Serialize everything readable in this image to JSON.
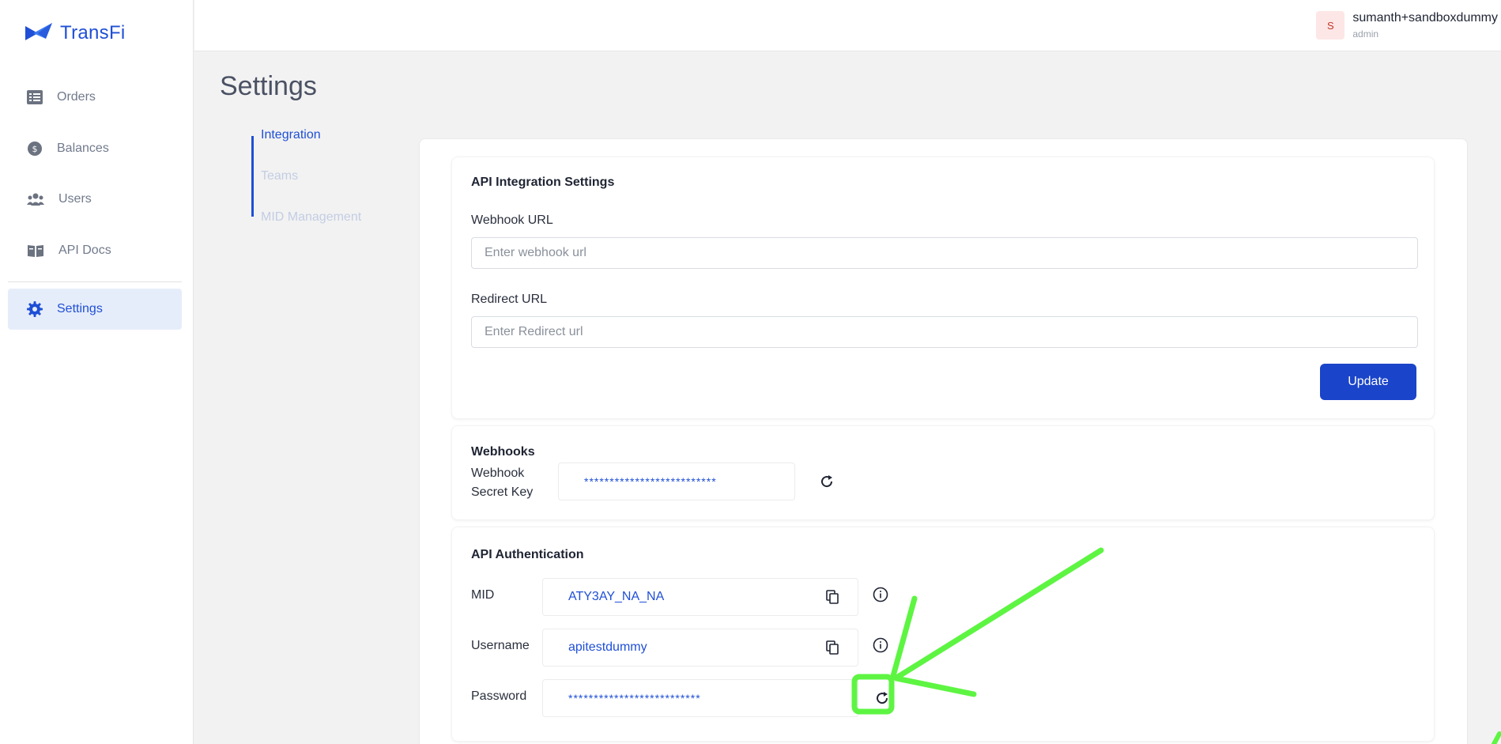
{
  "brand": {
    "name": "TransFi"
  },
  "sidebar": {
    "items": [
      {
        "label": "Orders",
        "icon": "list-icon"
      },
      {
        "label": "Balances",
        "icon": "coin-icon"
      },
      {
        "label": "Users",
        "icon": "users-icon"
      },
      {
        "label": "API Docs",
        "icon": "book-icon"
      },
      {
        "label": "Settings",
        "icon": "gear-icon",
        "active": true
      }
    ]
  },
  "header": {
    "user": {
      "initial": "S",
      "name": "sumanth+sandboxdummy",
      "role": "admin"
    }
  },
  "page": {
    "title": "Settings"
  },
  "subnav": {
    "items": [
      {
        "label": "Integration",
        "active": true
      },
      {
        "label": "Teams"
      },
      {
        "label": "MID Management"
      }
    ]
  },
  "api_integration": {
    "title": "API Integration Settings",
    "webhook_url": {
      "label": "Webhook URL",
      "placeholder": "Enter webhook url",
      "value": ""
    },
    "redirect_url": {
      "label": "Redirect URL",
      "placeholder": "Enter Redirect url",
      "value": ""
    },
    "update_label": "Update"
  },
  "webhooks": {
    "title": "Webhooks",
    "secret_label_line1": "Webhook",
    "secret_label_line2": "Secret Key",
    "secret_value": "**************************"
  },
  "api_auth": {
    "title": "API Authentication",
    "mid": {
      "label": "MID",
      "value": "ATY3AY_NA_NA"
    },
    "username": {
      "label": "Username",
      "value": "apitestdummy"
    },
    "password": {
      "label": "Password",
      "value": "**************************"
    }
  },
  "colors": {
    "accent": "#1f4fd6",
    "primary_button": "#1a44c9",
    "annotation": "#5df542"
  }
}
